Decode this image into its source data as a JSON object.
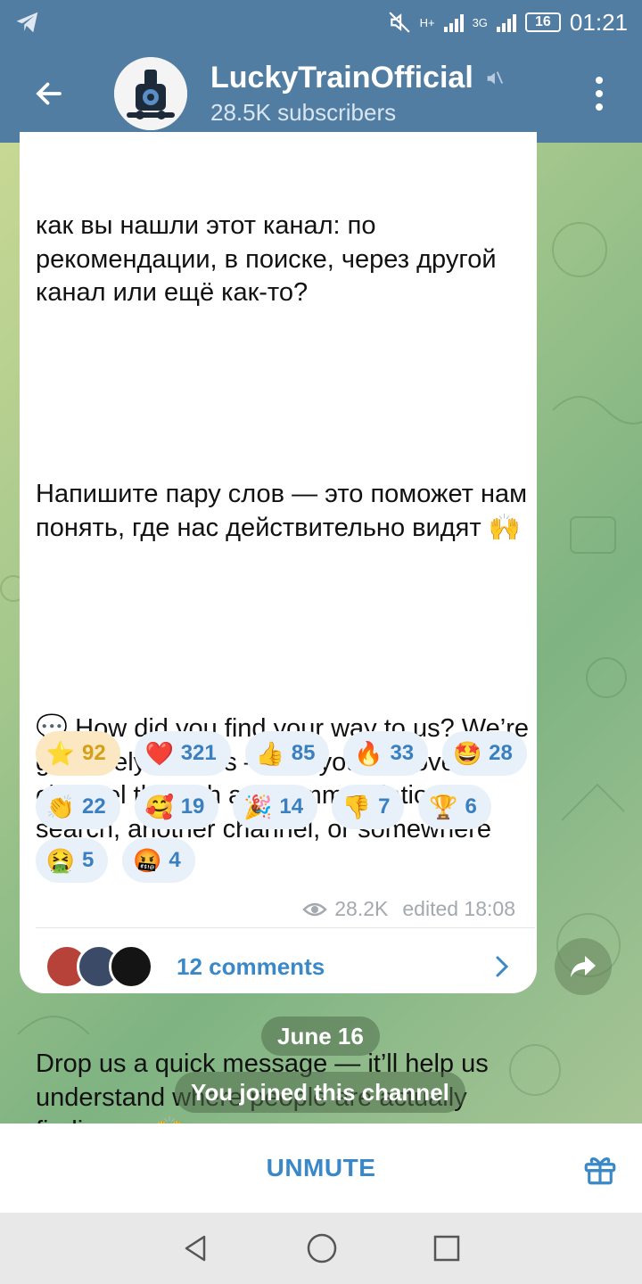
{
  "status_bar": {
    "time": "01:21",
    "network_1": "H+",
    "network_2": "3G",
    "battery": "16"
  },
  "header": {
    "title": "LuckyTrainOfficial",
    "subtitle": "28.5K subscribers"
  },
  "message": {
    "paragraphs": [
      "как вы нашли этот канал: по рекомендации, в поиске, через другой канал или ещё как-то?",
      "Напишите пару слов — это поможет нам понять, где нас действительно видят 🙌",
      "💬 How did you find your way to us? We’re genuinely curious — did you discover this channel through a recommendation, search, another channel, or somewhere else?",
      "Drop us a quick message — it’ll help us understand where people are actually finding us 🙌"
    ],
    "reactions": [
      {
        "emoji": "⭐",
        "count": "92"
      },
      {
        "emoji": "❤️",
        "count": "321"
      },
      {
        "emoji": "👍",
        "count": "85"
      },
      {
        "emoji": "🔥",
        "count": "33"
      },
      {
        "emoji": "🤩",
        "count": "28"
      },
      {
        "emoji": "👏",
        "count": "22"
      },
      {
        "emoji": "🥰",
        "count": "19"
      },
      {
        "emoji": "🎉",
        "count": "14"
      },
      {
        "emoji": "👎",
        "count": "7"
      },
      {
        "emoji": "🏆",
        "count": "6"
      },
      {
        "emoji": "🤮",
        "count": "5"
      },
      {
        "emoji": "🤬",
        "count": "4"
      }
    ],
    "views": "28.2K",
    "edited": "edited 18:08",
    "comments_label": "12 comments"
  },
  "date_pill": "June 16",
  "service_message": "You joined this channel",
  "bottom": {
    "unmute_label": "UNMUTE"
  },
  "colors": {
    "header": "#517da2",
    "accent": "#3a88c8",
    "starred_reaction": "#fbe8c3"
  }
}
